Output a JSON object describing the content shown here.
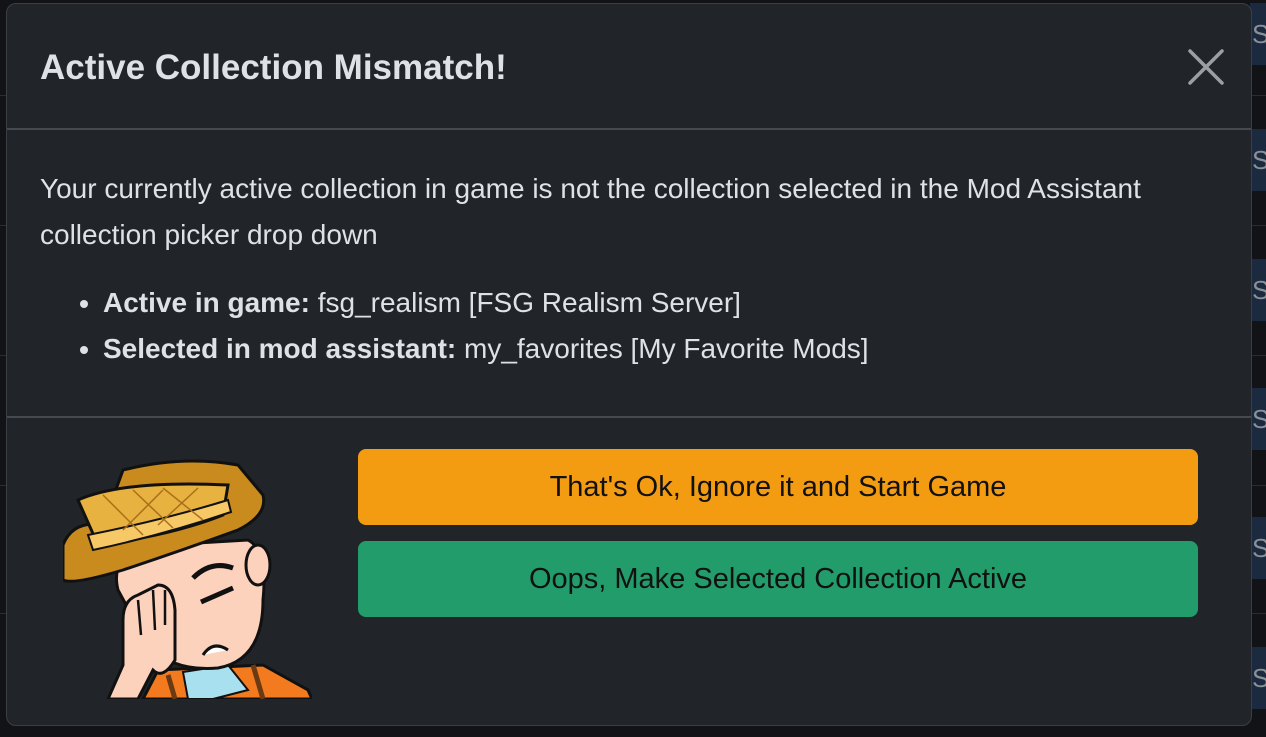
{
  "modal": {
    "title": "Active Collection Mismatch!",
    "message": "Your currently active collection in game is not the collection selected in the Mod Assistant collection picker drop down",
    "items": [
      {
        "label": "Active in game:",
        "value": "fsg_realism [FSG Realism Server]"
      },
      {
        "label": "Selected in mod assistant:",
        "value": "my_favorites [My Favorite Mods]"
      }
    ],
    "buttons": {
      "ignore": "That's Ok, Ignore it and Start Game",
      "make_active": "Oops, Make Selected Collection Active"
    }
  },
  "background": {
    "cell_text": "Sa"
  },
  "colors": {
    "ignore": "#f39c12",
    "make_active": "#229c6a",
    "modal_bg": "#212529"
  }
}
